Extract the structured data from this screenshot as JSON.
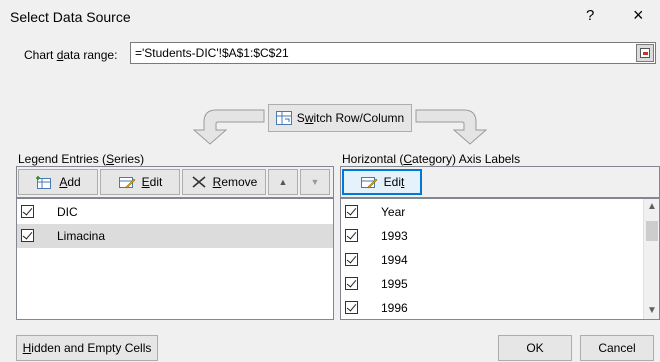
{
  "dialog": {
    "title": "Select Data Source",
    "help_label": "?",
    "close_label": "×"
  },
  "range": {
    "label_pre": "Chart ",
    "label_key": "d",
    "label_post": "ata range:",
    "value": "='Students-DIC'!$A$1:$C$21"
  },
  "switch": {
    "pre": "S",
    "key": "w",
    "post": "itch Row/Column"
  },
  "legend": {
    "label_pre": "Legend Entries (",
    "label_key": "S",
    "label_post": "eries)",
    "add_key": "A",
    "add_post": "dd",
    "edit_key": "E",
    "edit_post": "dit",
    "remove_key": "R",
    "remove_post": "emove",
    "move_up": "▲",
    "move_down": "▼",
    "items": [
      {
        "label": "DIC",
        "checked": true,
        "selected": false
      },
      {
        "label": "Limacina",
        "checked": true,
        "selected": true
      }
    ]
  },
  "axis": {
    "label_pre": "Horizontal (",
    "label_key": "C",
    "label_post": "ategory) Axis Labels",
    "edit_pre": "Edi",
    "edit_key": "t",
    "items": [
      {
        "label": "Year",
        "checked": true
      },
      {
        "label": "1993",
        "checked": true
      },
      {
        "label": "1994",
        "checked": true
      },
      {
        "label": "1995",
        "checked": true
      },
      {
        "label": "1996",
        "checked": true
      }
    ],
    "scroll_up": "▲",
    "scroll_down": "▼"
  },
  "footer": {
    "hidden_key": "H",
    "hidden_post": "idden and Empty Cells",
    "ok": "OK",
    "cancel": "Cancel"
  }
}
